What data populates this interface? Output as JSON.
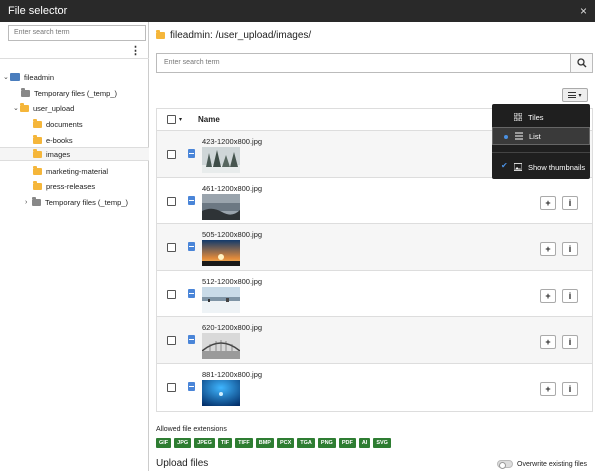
{
  "window": {
    "title": "File selector",
    "close": "×"
  },
  "sidebar": {
    "search_placeholder": "Enter search term",
    "menu": "⋮",
    "tree": [
      {
        "label": "fileadmin",
        "icon": "server-icon",
        "chev": "⌄"
      },
      {
        "label": "Temporary files (_temp_)",
        "icon": "folder-grey-icon"
      },
      {
        "label": "user_upload",
        "icon": "folder-icon",
        "chev": "⌄"
      },
      {
        "label": "documents",
        "icon": "folder-icon"
      },
      {
        "label": "e-books",
        "icon": "folder-icon"
      },
      {
        "label": "images",
        "icon": "folder-icon",
        "selected": true
      },
      {
        "label": "marketing-material",
        "icon": "folder-icon"
      },
      {
        "label": "press-releases",
        "icon": "folder-icon"
      },
      {
        "label": "Temporary files (_temp_)",
        "icon": "folder-grey-icon",
        "chev": "›"
      }
    ]
  },
  "main": {
    "path": "fileadmin: /user_upload/images/",
    "search_placeholder": "Enter search term",
    "table_header": "Name",
    "files": [
      {
        "name": "423-1200x800.jpg"
      },
      {
        "name": "461-1200x800.jpg"
      },
      {
        "name": "505-1200x800.jpg"
      },
      {
        "name": "512-1200x800.jpg"
      },
      {
        "name": "620-1200x800.jpg"
      },
      {
        "name": "881-1200x800.jpg"
      }
    ],
    "add_label": "+",
    "info_label": "i",
    "view_menu": {
      "tiles": "Tiles",
      "list": "List",
      "show_thumbnails": "Show thumbnails"
    },
    "allowed_extensions_title": "Allowed file extensions",
    "extensions": [
      "GIF",
      "JPG",
      "JPEG",
      "TIF",
      "TIFF",
      "BMP",
      "PCX",
      "TGA",
      "PNG",
      "PDF",
      "AI",
      "SVG"
    ],
    "upload_title": "Upload files",
    "overwrite_label": "Overwrite existing files"
  },
  "colors": {
    "titlebar": "#292929",
    "folder": "#f5b63a",
    "ext_badge": "#2e7d32",
    "accent": "#4a90e2"
  }
}
